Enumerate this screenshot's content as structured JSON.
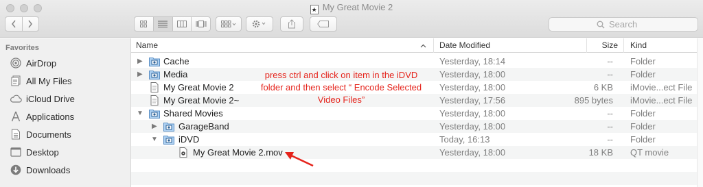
{
  "window": {
    "title": "My Great Movie 2"
  },
  "toolbar": {
    "back_icon": "chevron-left-icon",
    "forward_icon": "chevron-right-icon",
    "view_icons": [
      "icon-view-icon",
      "list-view-icon",
      "column-view-icon",
      "coverflow-view-icon"
    ],
    "arrange_icon": "arrange-grid-icon",
    "action_icon": "gear-icon",
    "share_icon": "share-icon",
    "tag_icon": "tag-icon"
  },
  "search": {
    "placeholder": "Search"
  },
  "sidebar": {
    "heading": "Favorites",
    "items": [
      {
        "label": "AirDrop",
        "icon": "airdrop-icon"
      },
      {
        "label": "All My Files",
        "icon": "all-files-icon"
      },
      {
        "label": "iCloud Drive",
        "icon": "cloud-icon"
      },
      {
        "label": "Applications",
        "icon": "applications-icon"
      },
      {
        "label": "Documents",
        "icon": "document-icon"
      },
      {
        "label": "Desktop",
        "icon": "desktop-icon"
      },
      {
        "label": "Downloads",
        "icon": "download-icon"
      }
    ]
  },
  "columns": {
    "name": "Name",
    "date": "Date Modified",
    "size": "Size",
    "kind": "Kind"
  },
  "files": [
    {
      "name": "Cache",
      "date": "Yesterday, 18:14",
      "size": "--",
      "kind": "Folder",
      "icon": "imovie-folder-icon",
      "disclosure": "collapsed"
    },
    {
      "name": "Media",
      "date": "Yesterday, 18:00",
      "size": "--",
      "kind": "Folder",
      "icon": "imovie-folder-icon",
      "disclosure": "collapsed"
    },
    {
      "name": "My Great Movie 2",
      "date": "Yesterday, 18:00",
      "size": "6 KB",
      "kind": "iMovie...ect File",
      "icon": "imovie-project-icon",
      "disclosure": "none"
    },
    {
      "name": "My Great Movie 2~",
      "date": "Yesterday, 17:56",
      "size": "895 bytes",
      "kind": "iMovie...ect File",
      "icon": "imovie-project-icon",
      "disclosure": "none"
    },
    {
      "name": "Shared Movies",
      "date": "Yesterday, 18:00",
      "size": "--",
      "kind": "Folder",
      "icon": "imovie-folder-icon",
      "disclosure": "expanded"
    },
    {
      "name": "GarageBand",
      "date": "Yesterday, 18:00",
      "size": "--",
      "kind": "Folder",
      "icon": "imovie-folder-icon",
      "disclosure": "collapsed"
    },
    {
      "name": "iDVD",
      "date": "Today, 16:13",
      "size": "--",
      "kind": "Folder",
      "icon": "imovie-folder-icon",
      "disclosure": "expanded"
    },
    {
      "name": "My Great Movie 2.mov",
      "date": "Yesterday, 18:00",
      "size": "18 KB",
      "kind": "QT movie",
      "icon": "quicktime-movie-icon",
      "disclosure": "none"
    }
  ],
  "annotation": {
    "lines": [
      "press ctrl and click on item in the iDVD",
      "folder and then select “ Encode Selected",
      "Video Files”"
    ],
    "color": "#e5231b"
  }
}
